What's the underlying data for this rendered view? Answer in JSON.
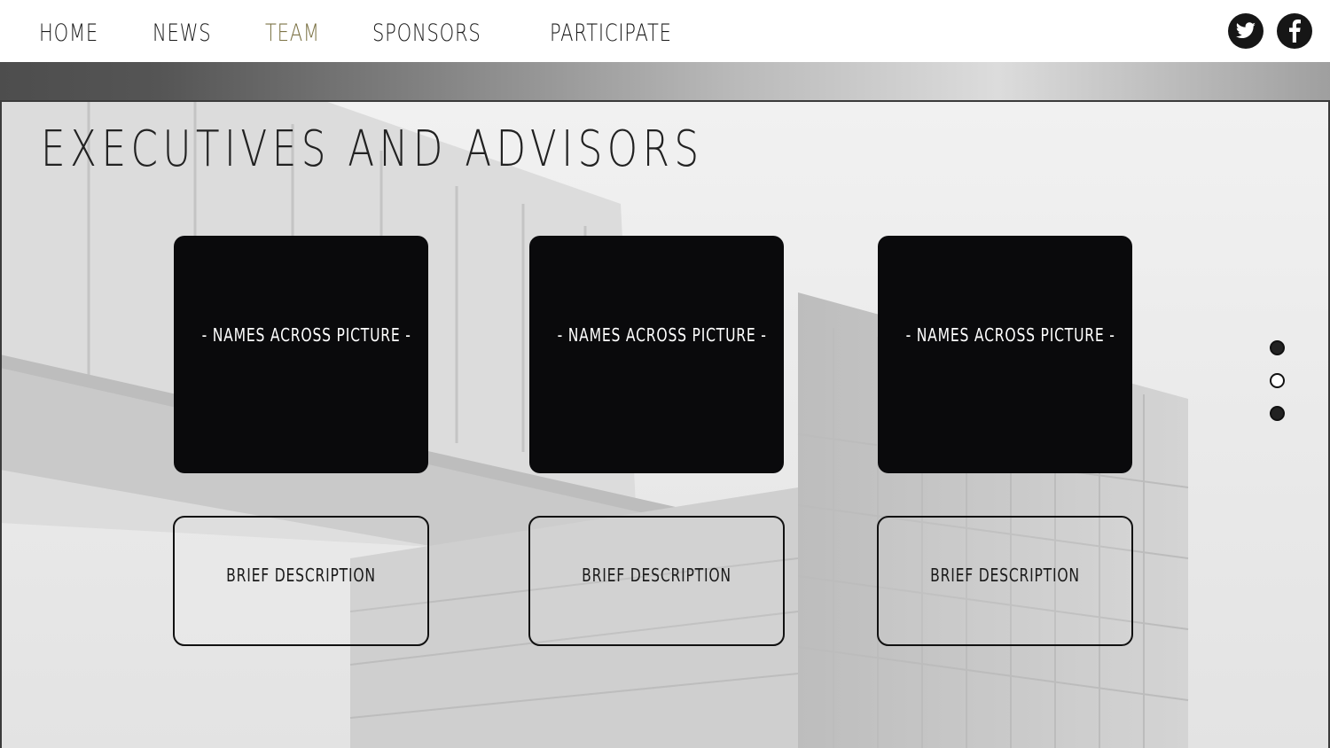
{
  "nav": {
    "links": [
      "HOME",
      "NEWS",
      "TEAM",
      "SPONSORS",
      "PARTICIPATE"
    ],
    "active": "TEAM",
    "social": [
      "twitter-icon",
      "facebook-icon"
    ]
  },
  "page": {
    "title": "EXECUTIVES AND ADVISORS"
  },
  "members": [
    {
      "photo_label": "-  NAMES ACROSS PICTURE  -",
      "description": "BRIEF DESCRIPTION"
    },
    {
      "photo_label": "-  NAMES ACROSS PICTURE  -",
      "description": "BRIEF DESCRIPTION"
    },
    {
      "photo_label": "-  NAMES ACROSS PICTURE  -",
      "description": "BRIEF DESCRIPTION"
    }
  ],
  "pager": {
    "count": 3,
    "active_index": 1
  },
  "colors": {
    "accent": "#7d7447",
    "card": "#0a0a0c",
    "icon_bg": "#161616"
  }
}
